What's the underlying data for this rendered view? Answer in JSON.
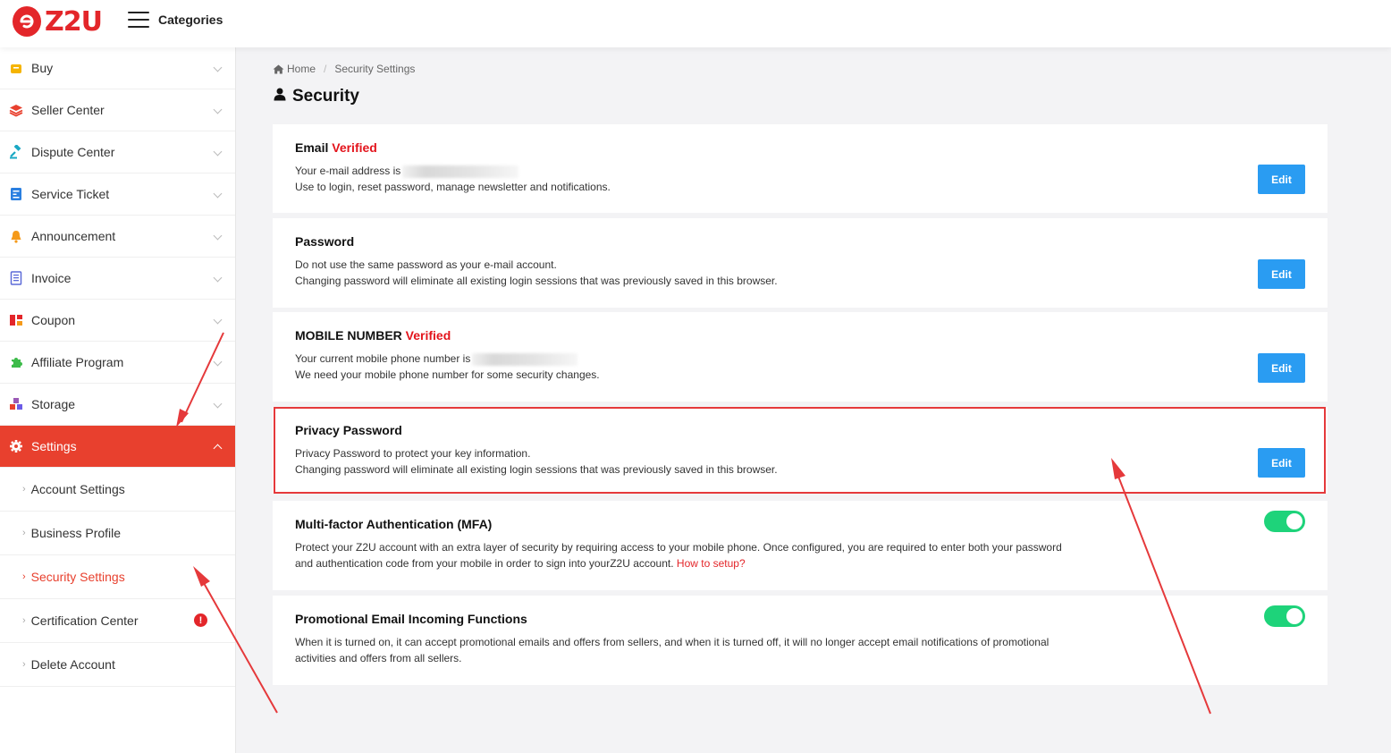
{
  "header": {
    "logo_text": "Z2U",
    "categories_label": "Categories"
  },
  "sidebar": {
    "items": [
      {
        "label": "Buy",
        "icon": "shopping-bag-icon",
        "color": "#f5b400"
      },
      {
        "label": "Seller Center",
        "icon": "layers-icon",
        "color": "#e8402e"
      },
      {
        "label": "Dispute Center",
        "icon": "gavel-icon",
        "color": "#1aa8c4"
      },
      {
        "label": "Service Ticket",
        "icon": "ticket-icon",
        "color": "#2a7fe0"
      },
      {
        "label": "Announcement",
        "icon": "bell-icon",
        "color": "#f59a1a"
      },
      {
        "label": "Invoice",
        "icon": "invoice-icon",
        "color": "#5d6bd8"
      },
      {
        "label": "Coupon",
        "icon": "coupon-icon",
        "color": "#e3262a"
      },
      {
        "label": "Affiliate Program",
        "icon": "puzzle-icon",
        "color": "#3dbb4a"
      },
      {
        "label": "Storage",
        "icon": "cubes-icon",
        "color": "#9b59b6"
      },
      {
        "label": "Settings",
        "icon": "gear-icon",
        "color": "#ffffff"
      }
    ],
    "sub_items": [
      {
        "label": "Account Settings"
      },
      {
        "label": "Business Profile"
      },
      {
        "label": "Security Settings"
      },
      {
        "label": "Certification Center",
        "badge": "!"
      },
      {
        "label": "Delete Account"
      }
    ]
  },
  "breadcrumb": {
    "home": "Home",
    "current": "Security Settings"
  },
  "page_title": "Security",
  "cards": {
    "email": {
      "title": "Email",
      "status": "Verified",
      "line1": "Your e-mail address is",
      "line2": "Use to login, reset password, manage newsletter and notifications.",
      "button": "Edit"
    },
    "password": {
      "title": "Password",
      "line1": "Do not use the same password as your e-mail account.",
      "line2": "Changing password will eliminate all existing login sessions that was previously saved in this browser.",
      "button": "Edit"
    },
    "mobile": {
      "title": "MOBILE NUMBER",
      "status": "Verified",
      "line1": "Your current mobile phone number is",
      "line2": "We need your mobile phone number for some security changes.",
      "button": "Edit"
    },
    "privacy": {
      "title": "Privacy Password",
      "line1": "Privacy Password to protect your key information.",
      "line2": "Changing password will eliminate all existing login sessions that was previously saved in this browser.",
      "button": "Edit"
    },
    "mfa": {
      "title": "Multi-factor Authentication (MFA)",
      "line1": "Protect your Z2U account with an extra layer of security by requiring access to your mobile phone. Once configured, you are required to enter both your password",
      "line2": "and authentication code from your mobile in order to sign into yourZ2U account.",
      "link": "How to setup?",
      "enabled": true
    },
    "promo": {
      "title": "Promotional Email Incoming Functions",
      "line1": "When it is turned on, it can accept promotional emails and offers from sellers, and when it is turned off, it will no longer accept email notifications of promotional",
      "line2": "activities and offers from all sellers.",
      "enabled": true
    }
  },
  "colors": {
    "brand": "#e3262a",
    "active_menu": "#e8402e",
    "button": "#2a9cf2",
    "toggle_on": "#1ed37a",
    "verified": "#e3141c"
  }
}
